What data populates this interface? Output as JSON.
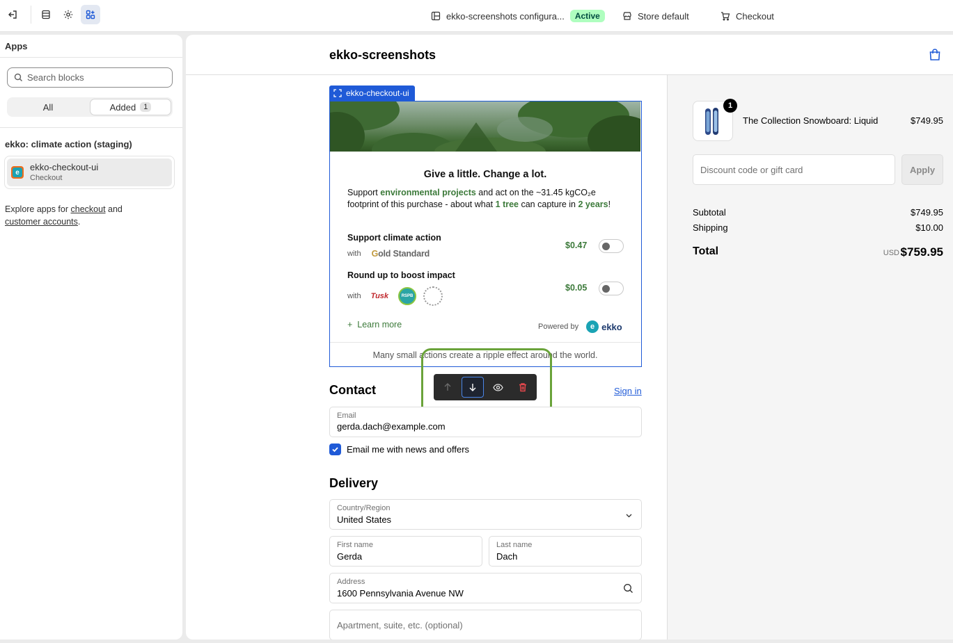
{
  "topbar": {
    "config_name": "ekko-screenshots configura...",
    "status": "Active",
    "store": "Store default",
    "page": "Checkout"
  },
  "sidebar": {
    "title": "Apps",
    "search_placeholder": "Search blocks",
    "filter_all": "All",
    "filter_added": "Added",
    "added_count": "1",
    "group_title": "ekko: climate action (staging)",
    "block_name": "ekko-checkout-ui",
    "block_target": "Checkout",
    "explore_prefix": "Explore apps for",
    "explore_link1": "checkout",
    "explore_mid": "and",
    "explore_link2": "customer accounts",
    "explore_end": "."
  },
  "checkout": {
    "shop_title": "ekko-screenshots",
    "selection_label": "ekko-checkout-ui",
    "widget": {
      "headline": "Give a little. Change a lot.",
      "text_1": "Support",
      "text_link": "environmental projects",
      "text_2": "and act on the ~31.45 kgCO₂e footprint of this purchase - about what",
      "text_trees": "1 tree",
      "text_3": "can capture in",
      "text_years": "2 years",
      "text_end": "!",
      "option1_title": "Support climate action",
      "option1_with": "with",
      "option1_partner_g": "G",
      "option1_partner": "old Standard",
      "option1_price": "$0.47",
      "option2_title": "Round up to boost impact",
      "option2_with": "with",
      "option2_price": "$0.05",
      "partner_tusk": "Tusk",
      "partner_rspb": "RSPB",
      "learn_more": "Learn more",
      "powered_by": "Powered by",
      "ekko_mark": "e",
      "ekko_word": "ekko",
      "footer": "Many small actions create a ripple effect around the world."
    },
    "contact_title": "Contact",
    "sign_in": "Sign in",
    "email_label": "Email",
    "email_value": "gerda.dach@example.com",
    "newsletter_label": "Email me with news and offers",
    "delivery_title": "Delivery",
    "country_label": "Country/Region",
    "country_value": "United States",
    "first_name_label": "First name",
    "first_name_value": "Gerda",
    "last_name_label": "Last name",
    "last_name_value": "Dach",
    "address_label": "Address",
    "address_value": "1600 Pennsylvania Avenue NW",
    "apartment_placeholder": "Apartment, suite, etc. (optional)"
  },
  "summary": {
    "quantity": "1",
    "product_name": "The Collection Snowboard: Liquid",
    "product_price": "$749.95",
    "discount_placeholder": "Discount code or gift card",
    "apply_label": "Apply",
    "subtotal_label": "Subtotal",
    "subtotal_value": "$749.95",
    "shipping_label": "Shipping",
    "shipping_value": "$10.00",
    "total_label": "Total",
    "currency": "USD",
    "total_value": "$759.95"
  },
  "colors": {
    "accent": "#1f5ad7",
    "green": "#3c7a3a",
    "highlight": "#6aa33a"
  }
}
